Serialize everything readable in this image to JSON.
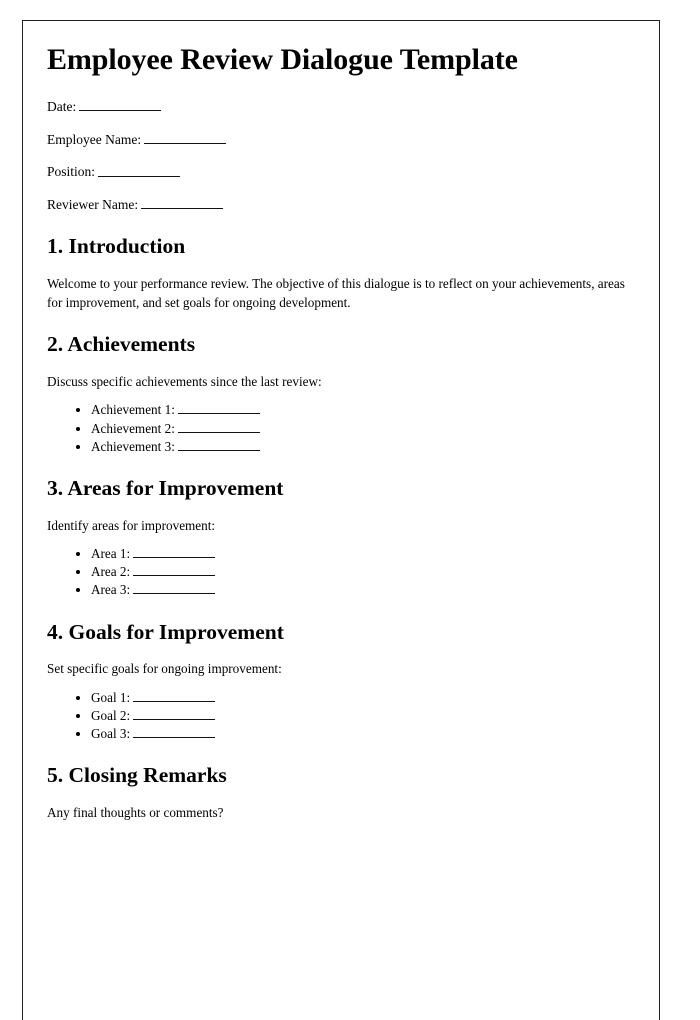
{
  "document": {
    "title": "Employee Review Dialogue Template",
    "meta_fields": [
      {
        "label": "Date:",
        "value": ""
      },
      {
        "label": "Employee Name:",
        "value": ""
      },
      {
        "label": "Position:",
        "value": ""
      },
      {
        "label": "Reviewer Name:",
        "value": ""
      }
    ],
    "sections": [
      {
        "heading": "1. Introduction",
        "intro": "Welcome to your performance review. The objective of this dialogue is to reflect on your achievements, areas for improvement, and set goals for ongoing development.",
        "items": []
      },
      {
        "heading": "2. Achievements",
        "intro": "Discuss specific achievements since the last review:",
        "items": [
          {
            "label": "Achievement 1:",
            "value": ""
          },
          {
            "label": "Achievement 2:",
            "value": ""
          },
          {
            "label": "Achievement 3:",
            "value": ""
          }
        ]
      },
      {
        "heading": "3. Areas for Improvement",
        "intro": "Identify areas for improvement:",
        "items": [
          {
            "label": "Area 1:",
            "value": ""
          },
          {
            "label": "Area 2:",
            "value": ""
          },
          {
            "label": "Area 3:",
            "value": ""
          }
        ]
      },
      {
        "heading": "4. Goals for Improvement",
        "intro": "Set specific goals for ongoing improvement:",
        "items": [
          {
            "label": "Goal 1:",
            "value": ""
          },
          {
            "label": "Goal 2:",
            "value": ""
          },
          {
            "label": "Goal 3:",
            "value": ""
          }
        ]
      },
      {
        "heading": "5. Closing Remarks",
        "intro": "Any final thoughts or comments?",
        "items": []
      }
    ]
  },
  "colors": {
    "text": "#000000",
    "page_border": "#222222",
    "page_background": "#ffffff"
  }
}
